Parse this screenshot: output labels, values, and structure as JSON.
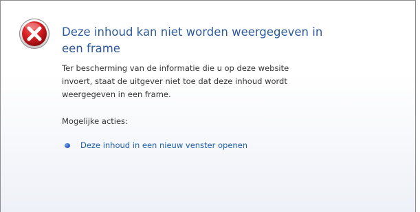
{
  "error": {
    "icon": "error-x-icon",
    "title": "Deze inhoud kan niet worden weergegeven in een frame",
    "description": "Ter bescherming van de informatie die u op deze website invoert, staat de uitgever niet toe dat deze inhoud wordt weergegeven in een frame."
  },
  "actions": {
    "heading": "Mogelijke acties:",
    "items": [
      {
        "label": "Deze inhoud in een nieuw venster openen"
      }
    ]
  },
  "colors": {
    "title": "#2d5b9a",
    "link": "#1f5fa8",
    "icon_red": "#c8171c"
  }
}
